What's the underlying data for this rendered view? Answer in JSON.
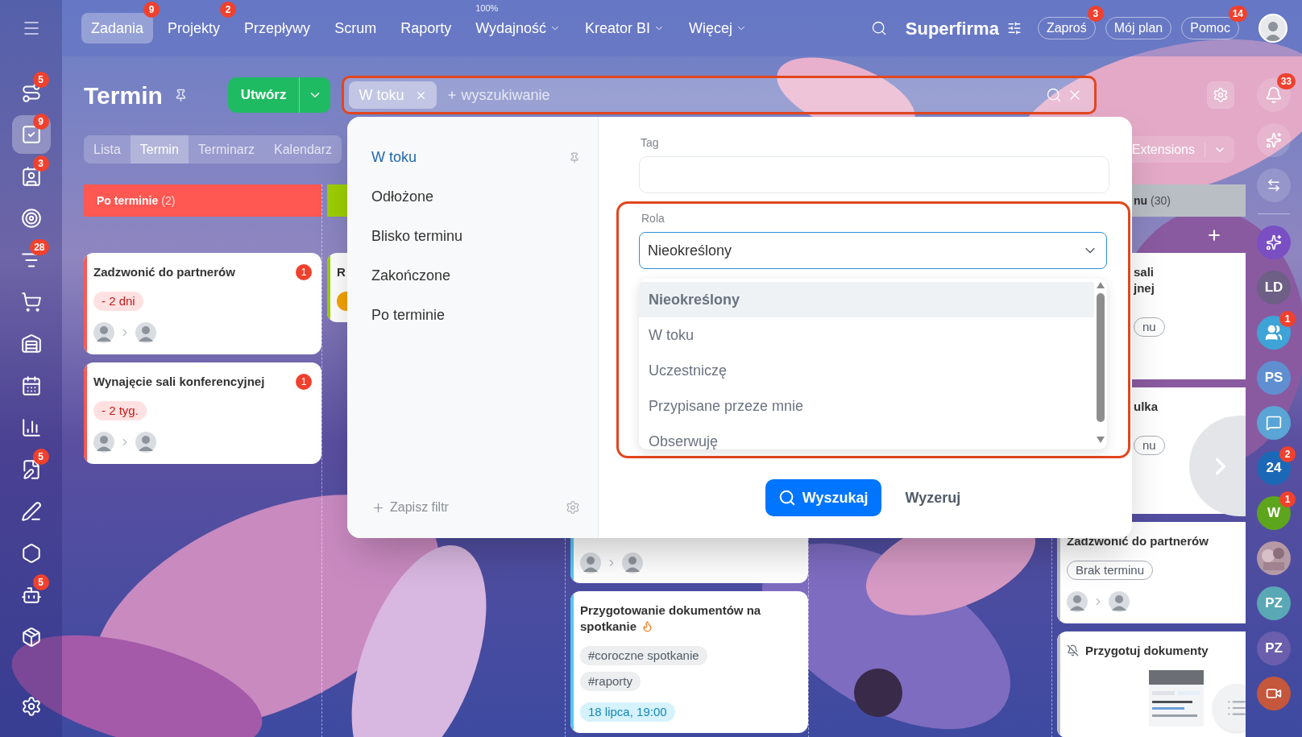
{
  "top_nav": {
    "items": [
      {
        "label": "Zadania",
        "selected": true,
        "badge": "9"
      },
      {
        "label": "Projekty",
        "selected": false,
        "badge": "2"
      },
      {
        "label": "Przepływy",
        "selected": false
      },
      {
        "label": "Scrum",
        "selected": false
      },
      {
        "label": "Raporty",
        "selected": false
      },
      {
        "label": "Wydajność",
        "selected": false,
        "superscript": "100%",
        "has_menu": true
      },
      {
        "label": "Kreator BI",
        "selected": false,
        "has_menu": true
      },
      {
        "label": "Więcej",
        "selected": false,
        "has_menu": true
      }
    ],
    "company": "Superfirma",
    "buttons": [
      {
        "label": "Zaproś",
        "badge": "3"
      },
      {
        "label": "Mój plan"
      },
      {
        "label": "Pomoc",
        "badge": "14"
      }
    ]
  },
  "left_sidebar": {
    "items": [
      {
        "kind": "route",
        "badge": "5",
        "selected": false
      },
      {
        "kind": "tasks",
        "badge": "9",
        "selected": true
      },
      {
        "kind": "contacts",
        "badge": "3",
        "selected": false
      },
      {
        "kind": "target",
        "selected": false
      },
      {
        "kind": "funnel",
        "badge": "28",
        "selected": false
      },
      {
        "kind": "cart",
        "selected": false
      },
      {
        "kind": "warehouse",
        "selected": false
      },
      {
        "kind": "calendar",
        "selected": false
      },
      {
        "kind": "chart",
        "selected": false
      },
      {
        "kind": "sign",
        "badge": "5",
        "selected": false
      },
      {
        "kind": "pen",
        "selected": false
      },
      {
        "kind": "hexagon",
        "selected": false
      },
      {
        "kind": "robot",
        "badge": "5",
        "selected": false
      },
      {
        "kind": "package",
        "selected": false
      }
    ]
  },
  "page": {
    "title": "Termin",
    "create_button": "Utwórz",
    "search": {
      "tag": "W toku",
      "placeholder": "wyszukiwanie"
    },
    "view_tabs": [
      {
        "label": "Lista",
        "selected": false
      },
      {
        "label": "Termin",
        "selected": true
      },
      {
        "label": "Terminarz",
        "selected": false
      },
      {
        "label": "Kalendarz",
        "selected": false
      }
    ],
    "extensions_button": "Extensions"
  },
  "columns": [
    {
      "kind": "full",
      "title": "Po terminie",
      "count": "(2)",
      "color": "#ff5752",
      "add_button": false,
      "cards": [
        {
          "kind": "full",
          "title": "Zadzwonić do partnerów",
          "counter": "1",
          "deadline": {
            "text": "- 2 dni",
            "kind": "overdue"
          },
          "people": true
        },
        {
          "kind": "full",
          "title": "Wynajęcie sali konferencyjnej",
          "counter": "1",
          "deadline": {
            "text": "- 2 tyg.",
            "kind": "overdue"
          },
          "people": true
        }
      ]
    },
    {
      "kind": "full",
      "color": "#9dcf00",
      "add_button": false,
      "cards": [
        {
          "kind": "full",
          "title": "R",
          "deadline": {
            "kind": "soon"
          }
        }
      ]
    },
    {
      "kind": "no-header",
      "color": "#55c7f0",
      "add_button": false,
      "cards": [
        {
          "kind": "tail",
          "people": true
        },
        {
          "kind": "full",
          "title": "Przygotowanie dokumentów na spotkanie",
          "hot": true,
          "tags": [
            "#coroczne spotkanie",
            "#raporty"
          ],
          "deadline": {
            "text": "18 lipca, 19:00",
            "kind": "date"
          }
        }
      ]
    },
    {
      "kind": "partial",
      "title": "nu",
      "count": "(30)",
      "color": "#b9bec5",
      "add_button": true,
      "cards": [
        {
          "kind": "partial",
          "title_lines": [
            "sali",
            "jnej"
          ],
          "deadline": {
            "text": "nu",
            "kind": "none"
          }
        },
        {
          "kind": "partial",
          "title_lines": [
            "ulka"
          ],
          "deadline": {
            "text": "nu",
            "kind": "none"
          }
        },
        {
          "kind": "full",
          "title": "Zadzwonić do partnerów",
          "deadline": {
            "text": "Brak terminu",
            "kind": "none"
          },
          "people": true
        },
        {
          "kind": "full",
          "title": "Przygotuj dokumenty",
          "muted": true,
          "attachment": {
            "kind": "picture"
          }
        }
      ]
    }
  ],
  "filter_popup": {
    "presets": [
      {
        "label": "W toku",
        "selected": true
      },
      {
        "label": "Odłożone",
        "selected": false
      },
      {
        "label": "Blisko terminu",
        "selected": false
      },
      {
        "label": "Zakończone",
        "selected": false
      },
      {
        "label": "Po terminie",
        "selected": false
      }
    ],
    "save_filter": "Zapisz filtr",
    "tag_field": {
      "label": "Tag"
    },
    "role_field": {
      "label": "Rola",
      "value": "Nieokreślony",
      "options": [
        {
          "label": "Nieokreślony",
          "selected": true
        },
        {
          "label": "W toku",
          "selected": false
        },
        {
          "label": "Uczestniczę",
          "selected": false
        },
        {
          "label": "Przypisane przeze mnie",
          "selected": false
        },
        {
          "label": "Obserwuję",
          "selected": false
        }
      ]
    },
    "search_button": "Wyszukaj",
    "reset_button": "Wyzeruj"
  },
  "right_sidebar": {
    "items": [
      {
        "kind": "bell",
        "badge": "33"
      },
      {
        "kind": "copilot"
      },
      {
        "kind": "chat-swap"
      },
      {
        "kind": "divider"
      },
      {
        "kind": "copilot-purple",
        "color": "#7a4fc4"
      },
      {
        "kind": "initials",
        "label": "LD",
        "color": "#6d5f86"
      },
      {
        "kind": "team",
        "badge": "1",
        "color": "#3ea3d6"
      },
      {
        "kind": "initials",
        "label": "PS",
        "color": "#5f8fd0"
      },
      {
        "kind": "chat",
        "color": "#5aa5d5"
      },
      {
        "kind": "initials",
        "label": "24",
        "color": "#1b69b6",
        "badge": "2"
      },
      {
        "kind": "initials",
        "label": "W",
        "color": "#5ea51e",
        "badge": "1"
      },
      {
        "kind": "picture"
      },
      {
        "kind": "initials",
        "label": "PZ",
        "color": "#5aa8b6"
      },
      {
        "kind": "initials",
        "label": "PZ",
        "color": "#6b5ead"
      },
      {
        "kind": "video",
        "color": "#c4573c"
      }
    ]
  }
}
